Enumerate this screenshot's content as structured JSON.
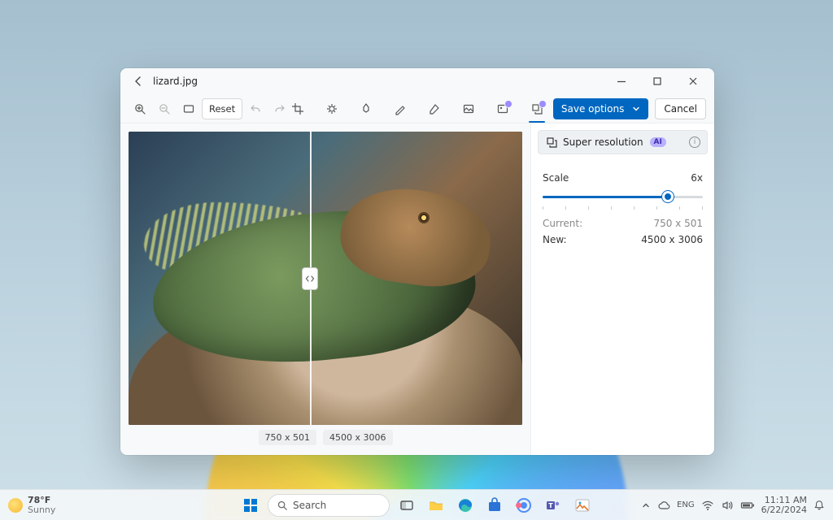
{
  "window": {
    "title": "lizard.jpg",
    "save_options": "Save options",
    "cancel": "Cancel",
    "reset": "Reset"
  },
  "toolbar_icons": {
    "zoom_in": "zoom-in-icon",
    "zoom_out": "zoom-out-icon",
    "fit": "fit-screen-icon",
    "undo": "undo-icon",
    "redo": "redo-icon",
    "crop": "crop-icon",
    "adjust": "adjustment-icon",
    "markup": "markup-icon",
    "retouch": "retouch-icon",
    "erase": "erase-icon",
    "background": "background-remove-icon",
    "generative": "generative-fill-icon",
    "super_res": "super-resolution-icon"
  },
  "image": {
    "current_dims": "750 x 501",
    "new_dims": "4500 x 3006"
  },
  "panel": {
    "title": "Super resolution",
    "ai_badge": "AI",
    "scale_label": "Scale",
    "scale_value": "6x",
    "current_label": "Current:",
    "current_value": "750 x 501",
    "new_label": "New:",
    "new_value": "4500 x 3006",
    "slider_percent": 78
  },
  "taskbar": {
    "weather_temp": "78°F",
    "weather_cond": "Sunny",
    "search": "Search",
    "time": "11:11 AM",
    "date": "6/22/2024"
  },
  "colors": {
    "accent": "#0067c0",
    "ai": "#9b8cff"
  }
}
